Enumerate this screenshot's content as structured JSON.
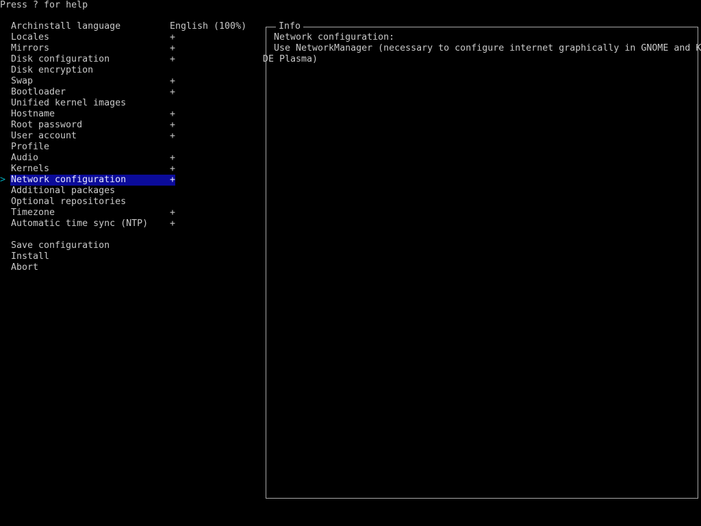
{
  "help_text": "Press ? for help",
  "cursor_glyph": ">",
  "menu": {
    "items": [
      {
        "label": "Archinstall language",
        "value": "English (100%)"
      },
      {
        "label": "Locales",
        "value": "+"
      },
      {
        "label": "Mirrors",
        "value": "+"
      },
      {
        "label": "Disk configuration",
        "value": "+"
      },
      {
        "label": "Disk encryption",
        "value": ""
      },
      {
        "label": "Swap",
        "value": "+"
      },
      {
        "label": "Bootloader",
        "value": "+"
      },
      {
        "label": "Unified kernel images",
        "value": ""
      },
      {
        "label": "Hostname",
        "value": "+"
      },
      {
        "label": "Root password",
        "value": "+"
      },
      {
        "label": "User account",
        "value": "+"
      },
      {
        "label": "Profile",
        "value": ""
      },
      {
        "label": "Audio",
        "value": "+"
      },
      {
        "label": "Kernels",
        "value": "+"
      },
      {
        "label": "Network configuration",
        "value": "+"
      },
      {
        "label": "Additional packages",
        "value": ""
      },
      {
        "label": "Optional repositories",
        "value": ""
      },
      {
        "label": "Timezone",
        "value": "+"
      },
      {
        "label": "Automatic time sync (NTP)",
        "value": "+"
      }
    ],
    "selected_index": 14,
    "actions": [
      {
        "label": "Save configuration"
      },
      {
        "label": "Install"
      },
      {
        "label": "Abort"
      }
    ]
  },
  "info": {
    "title": "Info",
    "line1": "Network configuration:",
    "line2": "Use NetworkManager (necessary to configure internet graphically in GNOME and K",
    "line3": "DE Plasma)"
  },
  "colors": {
    "background": "#000000",
    "text": "#c8c8c8",
    "selection": "#0b0b9a",
    "cursor": "#00a9b8"
  }
}
